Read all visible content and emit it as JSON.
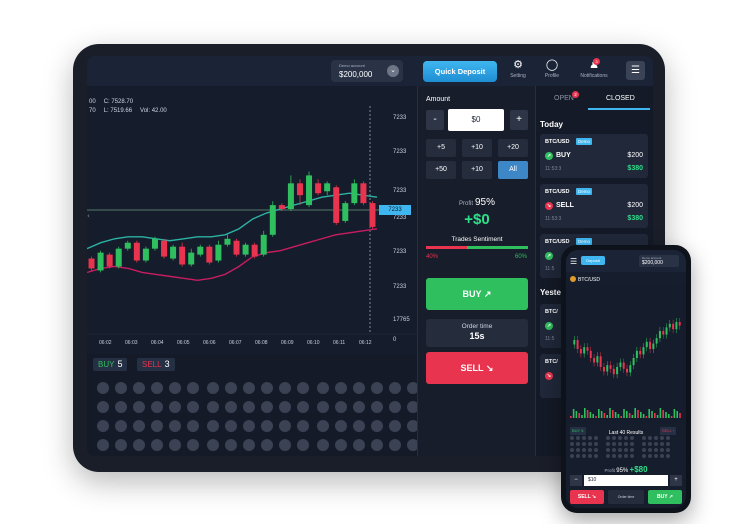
{
  "topbar": {
    "account_label": "Demo account",
    "balance": "$200,000",
    "chevron": "⌄",
    "quick_deposit": "Quick Deposit",
    "setting": "Setting",
    "profile": "Profile",
    "notifications": "Notifications",
    "notifications_count": "3",
    "icons": {
      "setting": "gear-icon",
      "profile": "user-icon",
      "notifications": "bell-icon",
      "menu": "list-icon"
    }
  },
  "chart": {
    "ohlc": {
      "open_high": "00",
      "close": "C: 7528.70",
      "low_high2": "70",
      "low": "L: 7519.66",
      "vol": "Vol: 42.00"
    },
    "price_tag": "7233",
    "chart_data": {
      "type": "candlestick",
      "y_axis_labels": [
        "7233",
        "7233",
        "7233",
        "7233",
        "7233",
        "7233",
        "17765",
        "0"
      ],
      "x_labels": [
        "06:02",
        "06:03",
        "06:04",
        "06:05",
        "06:06",
        "06:07",
        "06:08",
        "06:09",
        "06:10",
        "06:11",
        "06:12"
      ],
      "candles": [
        {
          "o": 0.28,
          "c": 0.23,
          "h": 0.29,
          "l": 0.22
        },
        {
          "o": 0.22,
          "c": 0.31,
          "h": 0.32,
          "l": 0.21
        },
        {
          "o": 0.3,
          "c": 0.24,
          "h": 0.31,
          "l": 0.23
        },
        {
          "o": 0.24,
          "c": 0.33,
          "h": 0.34,
          "l": 0.23
        },
        {
          "o": 0.33,
          "c": 0.36,
          "h": 0.37,
          "l": 0.32
        },
        {
          "o": 0.36,
          "c": 0.27,
          "h": 0.37,
          "l": 0.26
        },
        {
          "o": 0.27,
          "c": 0.33,
          "h": 0.34,
          "l": 0.26
        },
        {
          "o": 0.33,
          "c": 0.38,
          "h": 0.39,
          "l": 0.32
        },
        {
          "o": 0.37,
          "c": 0.29,
          "h": 0.38,
          "l": 0.28
        },
        {
          "o": 0.28,
          "c": 0.34,
          "h": 0.35,
          "l": 0.27
        },
        {
          "o": 0.34,
          "c": 0.25,
          "h": 0.36,
          "l": 0.24
        },
        {
          "o": 0.25,
          "c": 0.31,
          "h": 0.33,
          "l": 0.24
        },
        {
          "o": 0.3,
          "c": 0.34,
          "h": 0.35,
          "l": 0.29
        },
        {
          "o": 0.34,
          "c": 0.26,
          "h": 0.35,
          "l": 0.25
        },
        {
          "o": 0.27,
          "c": 0.35,
          "h": 0.37,
          "l": 0.26
        },
        {
          "o": 0.35,
          "c": 0.38,
          "h": 0.4,
          "l": 0.34
        },
        {
          "o": 0.37,
          "c": 0.3,
          "h": 0.38,
          "l": 0.29
        },
        {
          "o": 0.3,
          "c": 0.35,
          "h": 0.36,
          "l": 0.29
        },
        {
          "o": 0.35,
          "c": 0.29,
          "h": 0.36,
          "l": 0.28
        },
        {
          "o": 0.3,
          "c": 0.4,
          "h": 0.42,
          "l": 0.29
        },
        {
          "o": 0.4,
          "c": 0.55,
          "h": 0.57,
          "l": 0.39
        },
        {
          "o": 0.55,
          "c": 0.53,
          "h": 0.56,
          "l": 0.52
        },
        {
          "o": 0.53,
          "c": 0.66,
          "h": 0.7,
          "l": 0.52
        },
        {
          "o": 0.66,
          "c": 0.6,
          "h": 0.68,
          "l": 0.55
        },
        {
          "o": 0.55,
          "c": 0.7,
          "h": 0.72,
          "l": 0.54
        },
        {
          "o": 0.66,
          "c": 0.61,
          "h": 0.68,
          "l": 0.6
        },
        {
          "o": 0.62,
          "c": 0.66,
          "h": 0.67,
          "l": 0.6
        },
        {
          "o": 0.64,
          "c": 0.46,
          "h": 0.65,
          "l": 0.45
        },
        {
          "o": 0.47,
          "c": 0.56,
          "h": 0.57,
          "l": 0.46
        },
        {
          "o": 0.56,
          "c": 0.66,
          "h": 0.68,
          "l": 0.55
        },
        {
          "o": 0.66,
          "c": 0.56,
          "h": 0.67,
          "l": 0.55
        },
        {
          "o": 0.56,
          "c": 0.44,
          "h": 0.57,
          "l": 0.43
        }
      ],
      "series": [
        {
          "color": "#2bb3a3",
          "values": [
            0.33,
            0.36,
            0.38,
            0.39,
            0.39,
            0.38,
            0.37,
            0.38,
            0.39,
            0.39,
            0.4,
            0.43,
            0.48,
            0.51,
            0.53,
            0.55,
            0.57,
            0.59,
            0.6,
            0.61,
            0.6,
            0.59
          ]
        },
        {
          "color": "#c81d60",
          "values": [
            0.21,
            0.23,
            0.24,
            0.23,
            0.21,
            0.2,
            0.19,
            0.18,
            0.17,
            0.18,
            0.2,
            0.24,
            0.29,
            0.31,
            0.32,
            0.34,
            0.36,
            0.38,
            0.4,
            0.41,
            0.42,
            0.43
          ]
        }
      ]
    }
  },
  "results": {
    "buy_label": "BUY",
    "buy_count": "5",
    "sell_label": "SELL",
    "sell_count": "3"
  },
  "trade": {
    "amount_label": "Amount",
    "minus": "-",
    "plus": "+",
    "amount_value": "$0",
    "quick": [
      "+5",
      "+10",
      "+20",
      "+50",
      "+10",
      "All"
    ],
    "profit_label": "Profit",
    "profit_pct": "95%",
    "profit_amount": "+$0",
    "sentiment_title": "Trades Sentiment",
    "sentiment_sell_pct": "40%",
    "sentiment_buy_pct": "60%",
    "sentiment_sell_fraction": 0.4,
    "buy_label": "BUY ↗",
    "order_time_label": "Order time",
    "order_time_value": "15s",
    "sell_label": "SELL ↘"
  },
  "history": {
    "tab_open": "OPEN",
    "tab_open_badge": "2",
    "tab_closed": "CLOSED",
    "today": "Today",
    "yesterday": "Yeste",
    "cards": [
      {
        "pair": "BTC/USD",
        "demo": "Demo",
        "dir": "BUY",
        "amount": "$200",
        "time": "11:53:3",
        "payout": "$380"
      },
      {
        "pair": "BTC/USD",
        "demo": "Demo",
        "dir": "SELL",
        "amount": "$200",
        "time": "11:53:3",
        "payout": "$380"
      },
      {
        "pair": "BTC/USD",
        "demo": "Demo",
        "dir": "",
        "amount": "",
        "time": "11:5",
        "payout": ""
      },
      {
        "pair": "BTC/",
        "demo": "",
        "dir": "",
        "amount": "",
        "time": "11:5",
        "payout": ""
      },
      {
        "pair": "BTC/",
        "demo": "",
        "dir": "",
        "amount": "",
        "time": "",
        "payout": ""
      }
    ]
  },
  "phone": {
    "deposit": "Deposit",
    "account_label": "Demo account",
    "balance": "$200,000",
    "pair": "BTC/USD",
    "last_results": "Last 40 Results",
    "buy_badge": "BUY 5",
    "sell_badge": "SELL ›",
    "profit_label": "Profit",
    "profit_pct": "95%",
    "profit_amount": "+$80",
    "amount_value": "$10",
    "sell_label": "SELL ↘",
    "order_time": "Order time",
    "buy_label": "BUY ↗"
  }
}
